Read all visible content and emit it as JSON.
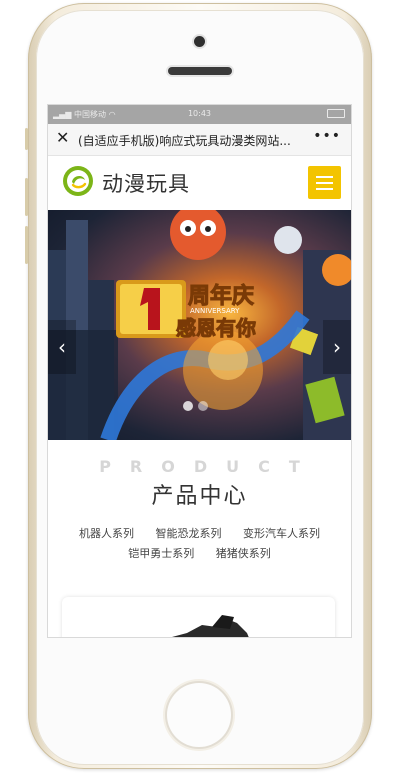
{
  "statusbar": {
    "carrier": "中国移动",
    "time": "10:43",
    "battery": "▭"
  },
  "tab": {
    "close_icon": "close-icon",
    "title": "(自适应手机版)响应式玩具动漫类网站...",
    "more": "•••"
  },
  "header": {
    "brand": "动漫玩具",
    "menu_icon": "menu-icon",
    "accent": "#f3c400"
  },
  "banner": {
    "big_number": "1",
    "line1": "周年庆",
    "anniversary": "ANNIVERSARY",
    "line2": "感恩有你",
    "prev": "‹",
    "next": "›"
  },
  "products": {
    "eyebrow": "PRODUCT",
    "title": "产品中心",
    "categories": [
      "机器人系列",
      "智能恐龙系列",
      "变形汽车人系列",
      "铠甲勇士系列",
      "猪猪侠系列"
    ]
  }
}
